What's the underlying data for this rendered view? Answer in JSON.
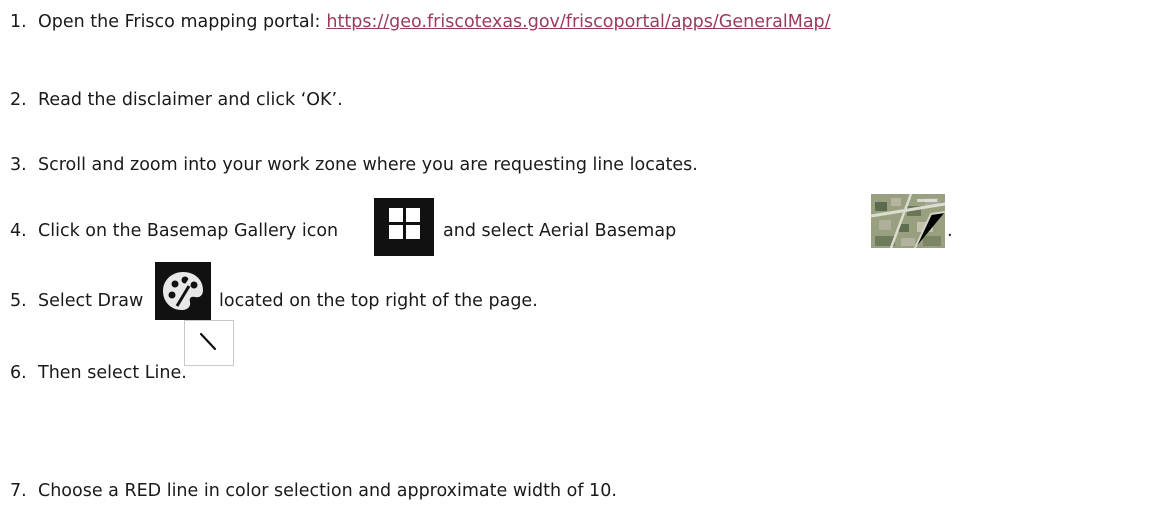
{
  "steps": [
    {
      "num": "1.",
      "text": "Open the Frisco mapping portal:",
      "link": "https://geo.friscotexas.gov/friscoportal/apps/GeneralMap/"
    },
    {
      "num": "2.",
      "text": "Read the disclaimer and click ‘OK’."
    },
    {
      "num": "3.",
      "text": "Scroll and zoom into your work zone where you are requesting line locates."
    },
    {
      "num": "4.",
      "text_a": "Click on the Basemap Gallery icon",
      "text_b": "and select Aerial Basemap",
      "text_c": "."
    },
    {
      "num": "5.",
      "text_a": "Select Draw",
      "text_b": "located on the top right of the page."
    },
    {
      "num": "6.",
      "text": "Then select Line."
    },
    {
      "num": "7.",
      "text": "Choose a RED line in color selection and approximate width of 10."
    }
  ],
  "icons": {
    "basemap_gallery": "grid-icon",
    "aerial_basemap": "aerial-map-thumbnail",
    "draw": "palette-icon",
    "line": "line-tool-icon"
  },
  "colors": {
    "link": "#9b3a5c",
    "text": "#1a1a1a",
    "icon_dark": "#111111"
  }
}
